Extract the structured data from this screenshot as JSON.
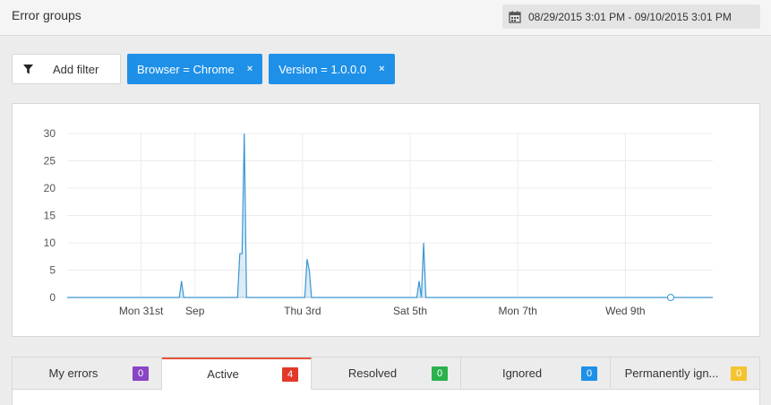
{
  "header": {
    "title": "Error groups",
    "date_range": "08/29/2015 3:01 PM - 09/10/2015 3:01 PM"
  },
  "filters": {
    "add_label": "Add filter",
    "chips": [
      {
        "label": "Browser = Chrome",
        "remove": "×"
      },
      {
        "label": "Version = 1.0.0.0",
        "remove": "×"
      }
    ]
  },
  "chart_data": {
    "type": "area",
    "color": "#3a96d4",
    "y_ticks": [
      "0",
      "5",
      "10",
      "15",
      "20",
      "25",
      "30"
    ],
    "ylim": [
      0,
      30
    ],
    "x_ticks": [
      "Mon 31st",
      "Sep",
      "Thu 3rd",
      "Sat 5th",
      "Mon 7th",
      "Wed 9th"
    ],
    "series": [
      {
        "points": [
          [
            "2015-08-29 15:00",
            0
          ],
          [
            "2015-08-31 17:00",
            0
          ],
          [
            "2015-08-31 18:00",
            3
          ],
          [
            "2015-08-31 19:00",
            0
          ],
          [
            "2015-09-01 19:00",
            0
          ],
          [
            "2015-09-01 20:00",
            8
          ],
          [
            "2015-09-01 21:00",
            8
          ],
          [
            "2015-09-01 22:00",
            30
          ],
          [
            "2015-09-01 23:00",
            0
          ],
          [
            "2015-09-03 01:00",
            0
          ],
          [
            "2015-09-03 02:00",
            7
          ],
          [
            "2015-09-03 03:00",
            5
          ],
          [
            "2015-09-03 04:00",
            0
          ],
          [
            "2015-09-05 03:00",
            0
          ],
          [
            "2015-09-05 04:00",
            3
          ],
          [
            "2015-09-05 05:00",
            0
          ],
          [
            "2015-09-05 06:00",
            10
          ],
          [
            "2015-09-05 07:00",
            0
          ],
          [
            "2015-09-10 15:00",
            0
          ]
        ]
      }
    ]
  },
  "tabs": [
    {
      "label": "My errors",
      "count": "0",
      "color": "#8a44c4",
      "active": false
    },
    {
      "label": "Active",
      "count": "4",
      "color": "#e2392b",
      "active": true
    },
    {
      "label": "Resolved",
      "count": "0",
      "color": "#2bb24c",
      "active": false
    },
    {
      "label": "Ignored",
      "count": "0",
      "color": "#1e90e8",
      "active": false
    },
    {
      "label": "Permanently ign...",
      "count": "0",
      "color": "#f4c430",
      "active": false
    }
  ]
}
